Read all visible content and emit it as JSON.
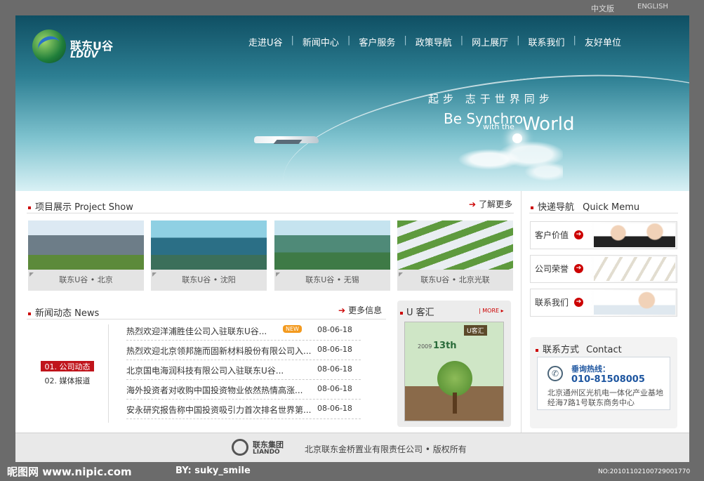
{
  "top_links": {
    "chinese": "中文版",
    "english": "ENGLISH"
  },
  "logo": {
    "cn": "联东U谷",
    "en": "LDUV"
  },
  "nav": [
    "走进U谷",
    "新闻中心",
    "客户服务",
    "政策导航",
    "网上展厅",
    "联系我们",
    "友好单位"
  ],
  "banner": {
    "slogan_cn": "起步 志于世界同步",
    "slogan_en_1": "Be Synchro",
    "slogan_en_2": "with the",
    "slogan_en_3": "World"
  },
  "projects": {
    "title": "项目展示 Project Show",
    "more": "了解更多",
    "items": [
      {
        "caption": "联东U谷 • 北京"
      },
      {
        "caption": "联东U谷 • 沈阳"
      },
      {
        "caption": "联东U谷 • 无锡"
      },
      {
        "caption": "联东U谷 • 北京光联"
      }
    ]
  },
  "news": {
    "title": "新闻动态 News",
    "more": "更多信息",
    "categories": [
      "01. 公司动态",
      "02. 媒体报道"
    ],
    "badge": "NEW",
    "items": [
      {
        "title": "热烈欢迎洋浦胜佳公司入驻联东U谷...",
        "date": "08-06-18"
      },
      {
        "title": "热烈欢迎北京领邦施而固新材料股份有限公司入...",
        "date": "08-06-18"
      },
      {
        "title": "北京国电海润科技有限公司入驻联东U谷...",
        "date": "08-06-18"
      },
      {
        "title": "海外投资者对收购中国投资物业依然热情高涨...",
        "date": "08-06-18"
      },
      {
        "title": "安永研究报告称中国投资吸引力首次排名世界第...",
        "date": "08-06-18"
      }
    ]
  },
  "uguest": {
    "title": "U 客汇",
    "more": "MORE",
    "cover_badge": "U客汇",
    "cover_year": "2009",
    "cover_issue": "13th"
  },
  "quick_menu": {
    "title": "快递导航",
    "title_en": "Quick Memu",
    "items": [
      "客户价值",
      "公司荣誉",
      "联系我们"
    ]
  },
  "contact": {
    "title": "联系方式",
    "title_en": "Contact",
    "hotline_label": "垂询热线：",
    "hotline": "010-81508005",
    "address": "北京通州区光机电一体化产业基地经海7路1号联东商务中心"
  },
  "footer": {
    "group_cn": "联东集团",
    "group_en": "LIANDO",
    "copyright": "北京联东金桥置业有限责任公司 • 版权所有"
  },
  "watermark": {
    "left": "昵图网 www.nipic.com",
    "by": "BY: suky_smile",
    "right": "NO:20101102100729001770"
  }
}
